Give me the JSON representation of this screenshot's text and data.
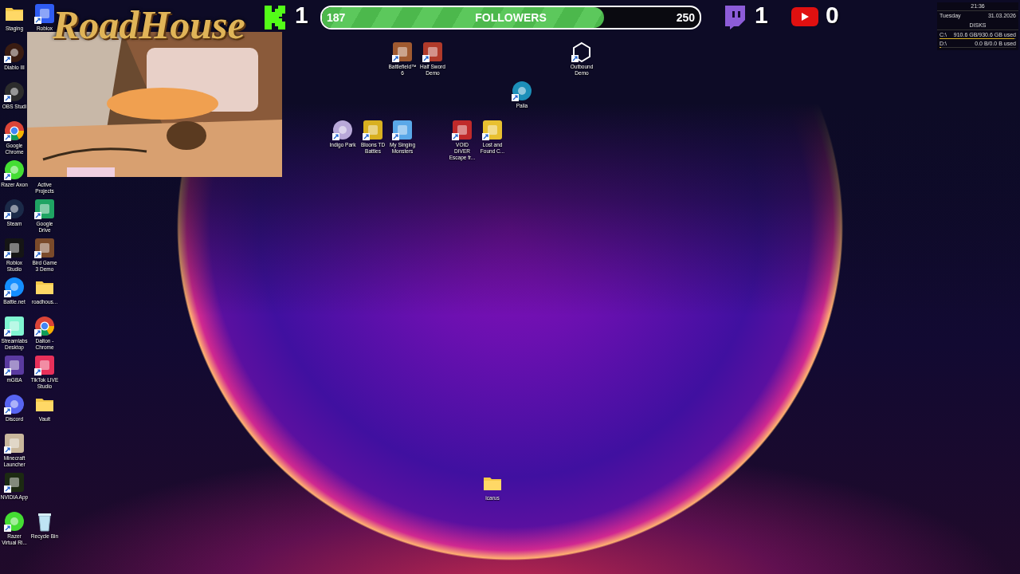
{
  "left_icons": [
    {
      "label": "Staging",
      "kind": "folder",
      "shortcut": false
    },
    {
      "label": "Roblox",
      "kind": "tile",
      "color": "#2f5cf2",
      "shortcut": true
    },
    {
      "label": "Diablo III",
      "kind": "round",
      "color": "#3a1c12",
      "shortcut": true
    },
    {
      "label": "OBS Studi",
      "kind": "round",
      "color": "#2c2c2c",
      "shortcut": true
    },
    {
      "label": "Google Chrome",
      "kind": "chrome",
      "shortcut": true
    },
    {
      "label": "Razer Axon",
      "kind": "round",
      "color": "#44dd33",
      "shortcut": true
    },
    {
      "label": "Active Projects"
    },
    {
      "label": "Steam",
      "kind": "round",
      "color": "#1b2a48",
      "shortcut": true
    },
    {
      "label": "Google Drive",
      "kind": "tile",
      "color": "#1fa463",
      "shortcut": true
    },
    {
      "label": "Roblox Studio",
      "kind": "tile",
      "color": "#151515",
      "shortcut": true
    },
    {
      "label": "Bird Game 3 Demo",
      "kind": "tile",
      "color": "#7a4a2a",
      "shortcut": true
    },
    {
      "label": "Battle.net",
      "kind": "round",
      "color": "#148eff",
      "shortcut": true
    },
    {
      "label": "roadhous...",
      "kind": "folder",
      "shortcut": false
    },
    {
      "label": "Streamlabs Desktop",
      "kind": "tile",
      "color": "#80f5d2",
      "shortcut": true
    },
    {
      "label": "Dalton - Chrome",
      "kind": "chrome",
      "shortcut": true
    },
    {
      "label": "mGBA",
      "kind": "tile",
      "color": "#5a3aa0",
      "shortcut": true
    },
    {
      "label": "TikTok LIVE Studio",
      "kind": "tile",
      "color": "#e8305a",
      "shortcut": true
    },
    {
      "label": "Discord",
      "kind": "round",
      "color": "#5865f2",
      "shortcut": true
    },
    {
      "label": "Vault",
      "kind": "folder",
      "shortcut": false
    },
    {
      "label": "Minecraft Launcher",
      "kind": "tile",
      "color": "#c9b79c",
      "shortcut": true
    },
    {
      "label": "NVIDIA App",
      "kind": "tile",
      "color": "#1c2a12",
      "shortcut": true
    },
    {
      "label": "Razer Virtual Ri...",
      "kind": "round",
      "color": "#44dd33",
      "shortcut": true
    },
    {
      "label": "Recycle Bin",
      "kind": "bin",
      "shortcut": false
    }
  ],
  "scattered_icons": [
    {
      "label": "Battlefield™ 6",
      "kind": "tile",
      "color": "#a05a30",
      "shortcut": true
    },
    {
      "label": "Half Sword Demo",
      "kind": "tile",
      "color": "#b03a2a",
      "shortcut": true
    },
    {
      "label": "Outbound Demo",
      "kind": "hexagon",
      "shortcut": true
    },
    {
      "label": "Palia",
      "kind": "round",
      "color": "#1c8fb8",
      "shortcut": true
    },
    {
      "label": "Indigo Park",
      "kind": "round",
      "color": "#b8a8d8",
      "shortcut": true
    },
    {
      "label": "Bloons TD Battles",
      "kind": "tile",
      "color": "#d8b020",
      "shortcut": true
    },
    {
      "label": "My Singing Monsters",
      "kind": "tile",
      "color": "#5aa8e8",
      "shortcut": true
    },
    {
      "label": "VOID DIVER Escape fr...",
      "kind": "tile",
      "color": "#c02a2a",
      "shortcut": true
    },
    {
      "label": "Lost and Found C...",
      "kind": "tile",
      "color": "#e8c030",
      "shortcut": true
    },
    {
      "label": "icarus",
      "kind": "folder",
      "shortcut": false
    }
  ],
  "stream_logo": "RoadHouse",
  "overlay": {
    "kick_count": "1",
    "followers": {
      "current": "187",
      "label": "FOLLOWERS",
      "goal": "250",
      "level": 0.746
    },
    "twitch_count": "1",
    "youtube_count": "0"
  },
  "widget": {
    "time": "21:36",
    "day": "Tuesday",
    "date": "31.03.2026",
    "disks_title": "DISKS",
    "disks": [
      {
        "drive": "C:\\",
        "usage": "910.6 GB/930.6 GB used",
        "level": 0.98
      },
      {
        "drive": "D:\\",
        "usage": "0.0 B/0.0 B used",
        "level": 0
      }
    ]
  }
}
